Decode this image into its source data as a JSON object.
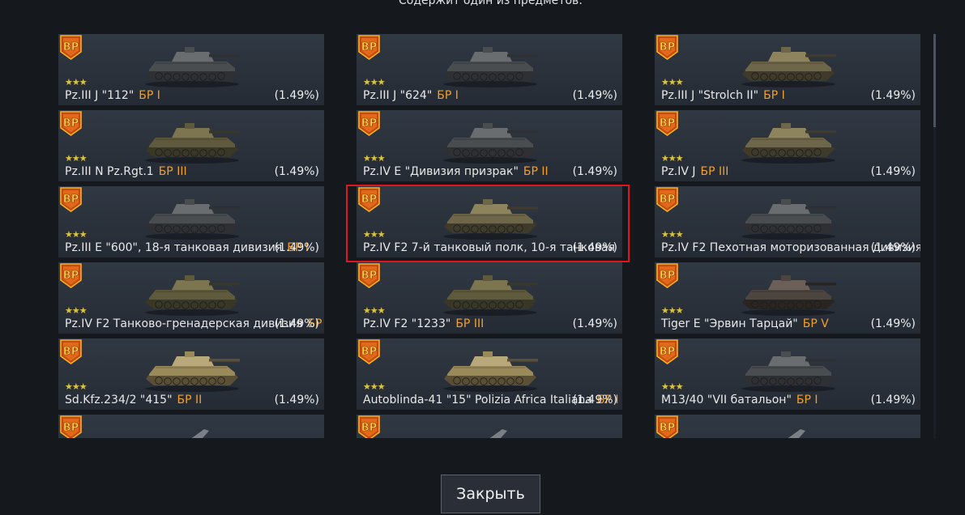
{
  "header": {
    "subtitle": "Содержит один из предметов:"
  },
  "items": [
    {
      "name": "Pz.III J \"112\"",
      "br": "БР I",
      "chance": "(1.49%)",
      "stars": "★★★",
      "camo": "grey"
    },
    {
      "name": "Pz.III J \"624\"",
      "br": "БР I",
      "chance": "(1.49%)",
      "stars": "★★★",
      "camo": "grey"
    },
    {
      "name": "Pz.III J \"Strolch II\"",
      "br": "БР I",
      "chance": "(1.49%)",
      "stars": "★★★",
      "camo": "tan"
    },
    {
      "name": "Pz.III N Pz.Rgt.1",
      "br": "БР III",
      "chance": "(1.49%)",
      "stars": "★★★",
      "camo": "camo"
    },
    {
      "name": "Pz.IV E \"Дивизия призрак\"",
      "br": "БР II",
      "chance": "(1.49%)",
      "stars": "★★★",
      "camo": "grey"
    },
    {
      "name": "Pz.IV J",
      "br": "БР III",
      "chance": "(1.49%)",
      "stars": "★★★",
      "camo": "tan"
    },
    {
      "name": "Pz.III E \"600\", 18-я танковая дивизия",
      "br": "БР I",
      "chance": "(1.49%)",
      "stars": "★★★",
      "camo": "grey"
    },
    {
      "name": "Pz.IV F2 7-й танковый полк, 10-я танковая",
      "br": "",
      "chance": "(1.49%)",
      "stars": "★★★",
      "camo": "tan"
    },
    {
      "name": "Pz.IV F2 Пехотная моторизованная дивизия",
      "br": "",
      "chance": "(1.49%)",
      "stars": "★★★",
      "camo": "grey"
    },
    {
      "name": "Pz.IV F2 Танково-гренадерская дивизия",
      "br": "БР I",
      "chance": "(1.49%)",
      "stars": "★★★",
      "camo": "camo"
    },
    {
      "name": "Pz.IV F2 \"1233\"",
      "br": "БР III",
      "chance": "(1.49%)",
      "stars": "★★★",
      "camo": "camo"
    },
    {
      "name": "Tiger E \"Эрвин Тарцай\"",
      "br": "БР V",
      "chance": "(1.49%)",
      "stars": "★★★",
      "camo": "dark"
    },
    {
      "name": "Sd.Kfz.234/2 \"415\"",
      "br": "БР II",
      "chance": "(1.49%)",
      "stars": "★★★",
      "camo": "sand"
    },
    {
      "name": "Autoblinda-41 \"15\" Polizia Africa Italiana",
      "br": "БР I",
      "chance": "(1.49%)",
      "stars": "★★★",
      "camo": "sand"
    },
    {
      "name": "M13/40 \"VII батальон\"",
      "br": "БР I",
      "chance": "(1.49%)",
      "stars": "★★★",
      "camo": "grey"
    },
    {
      "name": "",
      "br": "",
      "chance": "",
      "stars": "",
      "camo": "plane"
    },
    {
      "name": "",
      "br": "",
      "chance": "",
      "stars": "",
      "camo": "plane"
    },
    {
      "name": "",
      "br": "",
      "chance": "",
      "stars": "",
      "camo": "plane"
    }
  ],
  "badge": {
    "text": "BP"
  },
  "footer": {
    "close_label": "Закрыть"
  },
  "colors": {
    "br": "#f0a030",
    "stars": "#d7c34a",
    "highlight": "#e0161e"
  }
}
